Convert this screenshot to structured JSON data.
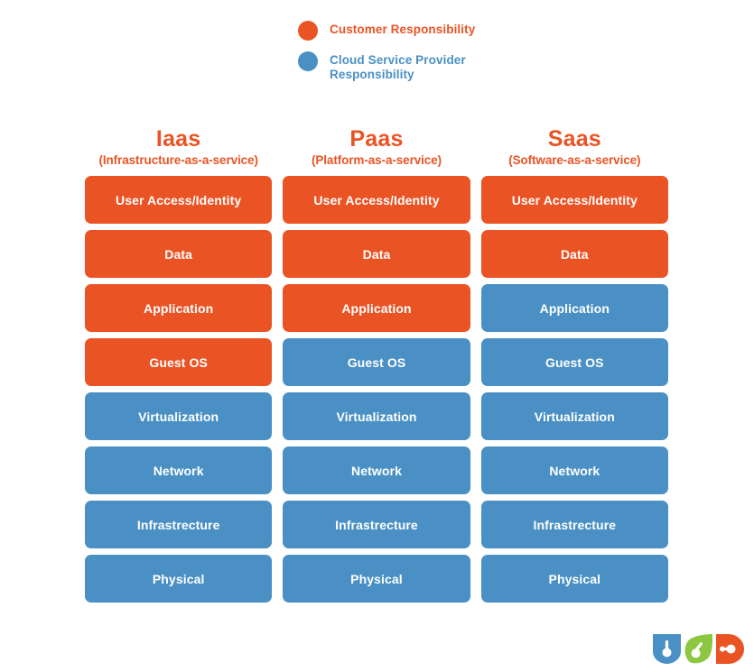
{
  "legend": {
    "items": [
      {
        "label": "Customer Responsibility",
        "color": "#EA5425",
        "icon": "legend-dot-icon"
      },
      {
        "label": "Cloud Service Provider\nResponsibility",
        "color": "#4A90C4",
        "icon": "legend-dot-icon"
      }
    ]
  },
  "colors": {
    "customer": "#EA5425",
    "provider": "#4A90C4",
    "badge_blue": "#4A90C4",
    "badge_green": "#8DC63F",
    "badge_orange": "#EA5425",
    "background": "#FFFFFF",
    "cell_text": "#FFFFFF"
  },
  "matrix": {
    "columns": [
      {
        "title": "Iaas",
        "subtitle": "(Infrastructure-as-a-service)"
      },
      {
        "title": "Paas",
        "subtitle": "(Platform-as-a-service)"
      },
      {
        "title": "Saas",
        "subtitle": "(Software-as-a-service)"
      }
    ],
    "layers": [
      "User Access/Identity",
      "Data",
      "Application",
      "Guest OS",
      "Virtualization",
      "Network",
      "Infrastrecture",
      "Physical"
    ],
    "responsibility": [
      [
        "customer",
        "customer",
        "customer"
      ],
      [
        "customer",
        "customer",
        "customer"
      ],
      [
        "customer",
        "customer",
        "provider"
      ],
      [
        "customer",
        "provider",
        "provider"
      ],
      [
        "provider",
        "provider",
        "provider"
      ],
      [
        "provider",
        "provider",
        "provider"
      ],
      [
        "provider",
        "provider",
        "provider"
      ],
      [
        "provider",
        "provider",
        "provider"
      ]
    ]
  },
  "brand_badges": [
    {
      "name": "shield-badge-icon",
      "color": "#4A90C4"
    },
    {
      "name": "leaf-badge-icon",
      "color": "#8DC63F"
    },
    {
      "name": "d-badge-icon",
      "color": "#EA5425"
    }
  ]
}
